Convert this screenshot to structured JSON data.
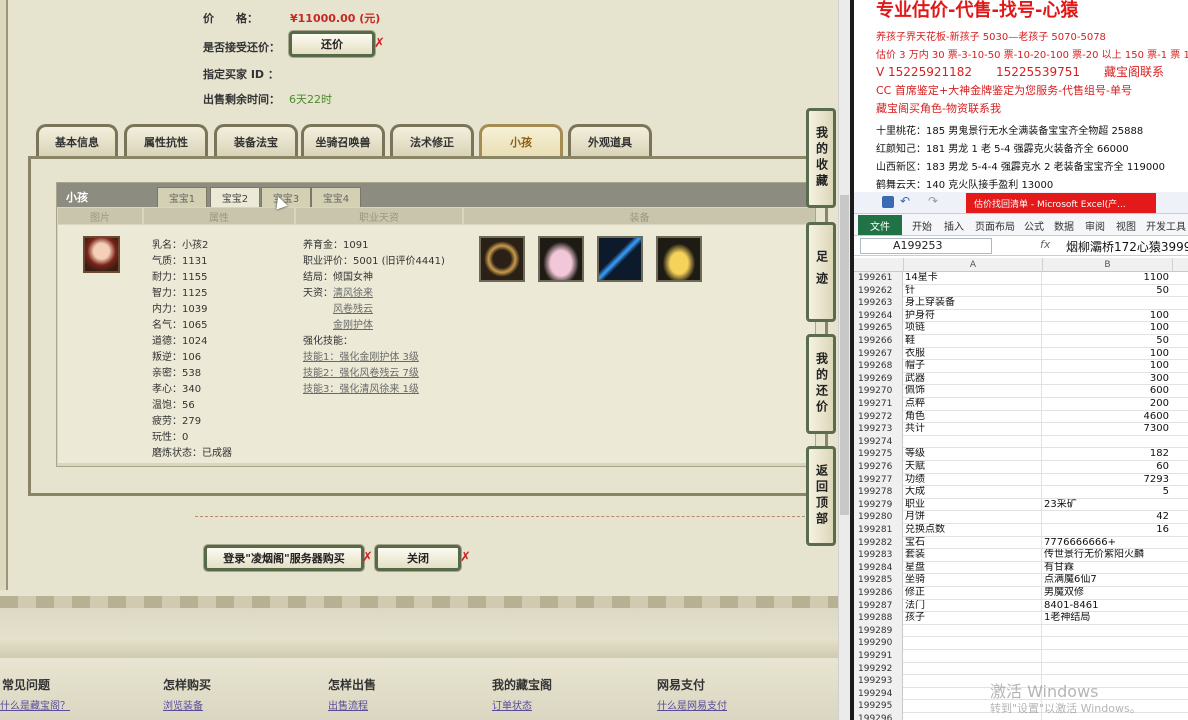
{
  "order": {
    "price_label": "价　　格：",
    "price_value": "¥11000.00 (元)",
    "accept_bargain_label": "是否接受还价：",
    "bargain_button": "还价",
    "buyer_id_label": "指定买家 ID ：",
    "remain_time_label": "出售剩余时间：",
    "remain_time_value": "6天22时"
  },
  "tabs": [
    "基本信息",
    "属性抗性",
    "装备法宝",
    "坐骑召唤兽",
    "法术修正",
    "小孩",
    "外观道具"
  ],
  "active_tab": "小孩",
  "child_panel": {
    "title": "小孩",
    "subtabs": [
      "宝宝1",
      "宝宝2",
      "宝宝3",
      "宝宝4"
    ],
    "active_subtab": "宝宝2",
    "columns": [
      "图片",
      "属性",
      "职业天资",
      "装备"
    ],
    "stats": [
      "乳名：小孩2",
      "气质：1131",
      "耐力：1155",
      "智力：1125",
      "内力：1039",
      "名气：1065",
      "道德：1024",
      "叛逆：106",
      "亲密：538",
      "孝心：340",
      "温饱：56",
      "疲劳：279",
      "玩性：0",
      "磨炼状态：已成器"
    ],
    "career": {
      "money": "养育金：1091",
      "rating": "职业评价：5001 (旧评价4441)",
      "ending": "结局：倾国女神",
      "talent_label": "天资：",
      "talents": [
        "清风徐来",
        "风卷残云",
        "金刚护体"
      ],
      "strength_label": "强化技能：",
      "skills": [
        "技能1：强化金刚护体 3级",
        "技能2：强化风卷残云 7级",
        "技能3：强化清风徐来 1级"
      ]
    }
  },
  "buttons": {
    "buy": "登录\"凌烟阁\"服务器购买",
    "close": "关闭"
  },
  "side_toolbar": [
    "我的收藏",
    "足迹",
    "我的还价",
    "返回顶部"
  ],
  "footer": {
    "headings": [
      "常见问题",
      "怎样购买",
      "怎样出售",
      "我的藏宝阁",
      "网易支付"
    ],
    "links": [
      "什么是藏宝阁？",
      "浏览装备",
      "出售流程",
      "订单状态",
      "什么是网易支付"
    ]
  },
  "notes": {
    "title": "专业估价-代售-找号-心猿",
    "lines": [
      "养孩子界天花板-新孩子 5030—老孩子 5070-5078",
      "估价 3 万内 30 票-3-10-50 票-10-20-100 票-20 以上 150 票-1 票 1",
      "V 15225921182　　15225539751　　藏宝阁联系",
      "CC 首席鉴定+大神金牌鉴定为您服务-代售组号-单号",
      "藏宝阁买角色-物资联系我",
      "十里桃花：185 男鬼景行无水全满装备宝宝齐全物超 25888",
      "红颜知己：181 男龙 1 老 5-4 强霹克火装备齐全 66000",
      "山西新区：183 男龙 5-4-4 强霹克水 2 老装备宝宝齐全 119000",
      "鹤舞云天：140 克火队接手盈利 13000"
    ]
  },
  "excel": {
    "window_title": "估价找回清单 - Microsoft Excel(产...",
    "ribbon_tabs": [
      "文件",
      "开始",
      "插入",
      "页面布局",
      "公式",
      "数据",
      "审阅",
      "视图",
      "开发工具"
    ],
    "name_box": "A199253",
    "formula_value": "烟柳灞桥172心猿3999",
    "col_headers": [
      "A",
      "B"
    ],
    "rows": [
      {
        "n": "199261",
        "a": "14星卡",
        "b": "1100"
      },
      {
        "n": "199262",
        "a": "针",
        "b": "50"
      },
      {
        "n": "199263",
        "a": "身上穿装备",
        "b": ""
      },
      {
        "n": "199264",
        "a": "护身符",
        "b": "100"
      },
      {
        "n": "199265",
        "a": "项链",
        "b": "100"
      },
      {
        "n": "199266",
        "a": "鞋",
        "b": "50"
      },
      {
        "n": "199267",
        "a": "衣服",
        "b": "100"
      },
      {
        "n": "199268",
        "a": "帽子",
        "b": "100"
      },
      {
        "n": "199269",
        "a": "武器",
        "b": "300"
      },
      {
        "n": "199270",
        "a": "佩饰",
        "b": "600"
      },
      {
        "n": "199271",
        "a": "点粹",
        "b": "200"
      },
      {
        "n": "199272",
        "a": "角色",
        "b": "4600"
      },
      {
        "n": "199273",
        "a": "共计",
        "b": "7300"
      },
      {
        "n": "199274",
        "a": "",
        "b": ""
      },
      {
        "n": "199275",
        "a": "等级",
        "b": "182"
      },
      {
        "n": "199276",
        "a": "天赋",
        "b": "60"
      },
      {
        "n": "199277",
        "a": "功绩",
        "b": "7293"
      },
      {
        "n": "199278",
        "a": "大成",
        "b": "5"
      },
      {
        "n": "199279",
        "a": "职业",
        "b": "23采矿"
      },
      {
        "n": "199280",
        "a": "月饼",
        "b": "42"
      },
      {
        "n": "199281",
        "a": "兑换点数",
        "b": "16"
      },
      {
        "n": "199282",
        "a": "宝石",
        "b": "7776666666+"
      },
      {
        "n": "199283",
        "a": "套装",
        "b": "传世景行无价紫阳火麟"
      },
      {
        "n": "199284",
        "a": "星盘",
        "b": "有甘霖"
      },
      {
        "n": "199285",
        "a": "坐骑",
        "b": "点满魔6仙7"
      },
      {
        "n": "199286",
        "a": "修正",
        "b": "男魔双修"
      },
      {
        "n": "199287",
        "a": "法门",
        "b": "8401-8461"
      },
      {
        "n": "199288",
        "a": "孩子",
        "b": "1老神结局"
      },
      {
        "n": "199289",
        "a": "",
        "b": ""
      },
      {
        "n": "199290",
        "a": "",
        "b": ""
      },
      {
        "n": "199291",
        "a": "",
        "b": ""
      },
      {
        "n": "199292",
        "a": "",
        "b": ""
      },
      {
        "n": "199293",
        "a": "",
        "b": ""
      },
      {
        "n": "199294",
        "a": "",
        "b": ""
      },
      {
        "n": "199295",
        "a": "",
        "b": ""
      },
      {
        "n": "199296",
        "a": "",
        "b": ""
      }
    ]
  },
  "watermark": {
    "line1": "激活 Windows",
    "line2": "转到\"设置\"以激活 Windows。"
  }
}
